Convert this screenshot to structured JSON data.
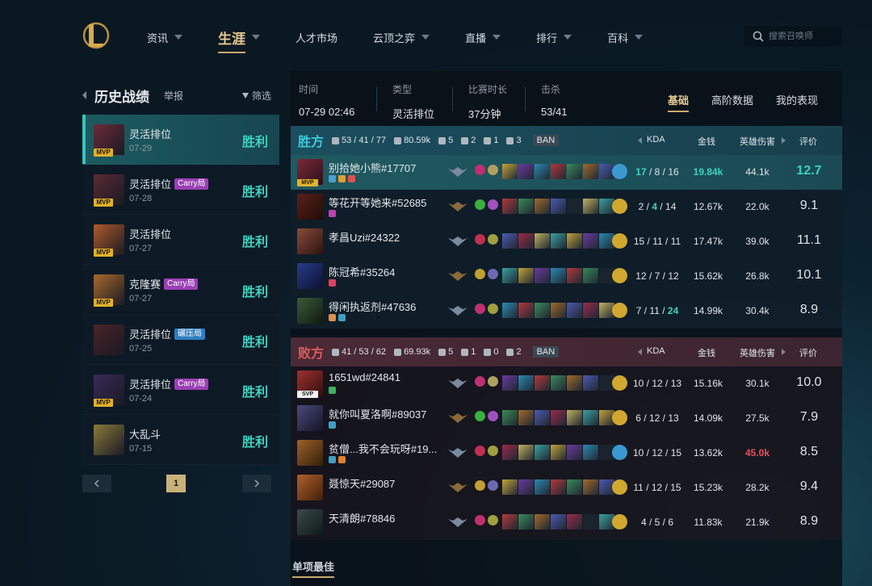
{
  "nav": {
    "items": [
      {
        "label": "资讯",
        "has_caret": true,
        "active": false
      },
      {
        "label": "生涯",
        "has_caret": true,
        "active": true
      },
      {
        "label": "人才市场",
        "has_caret": false,
        "active": false
      },
      {
        "label": "云顶之弈",
        "has_caret": true,
        "active": false
      },
      {
        "label": "直播",
        "has_caret": true,
        "active": false
      },
      {
        "label": "排行",
        "has_caret": true,
        "active": false
      },
      {
        "label": "百科",
        "has_caret": true,
        "active": false
      }
    ],
    "search_placeholder": "搜索召唤师"
  },
  "history": {
    "title": "历史战绩",
    "report": "举报",
    "filter": "筛选",
    "matches": [
      {
        "queue": "灵活排位",
        "tag": "",
        "tag_color": "",
        "date": "07-29",
        "result": "胜利",
        "mvp": true,
        "selected": true,
        "avatar_color": "#6b2a3a"
      },
      {
        "queue": "灵活排位",
        "tag": "Carry局",
        "tag_color": "#9b3fb5",
        "date": "07-28",
        "result": "胜利",
        "mvp": true,
        "selected": false,
        "avatar_color": "#5a2a34"
      },
      {
        "queue": "灵活排位",
        "tag": "",
        "tag_color": "",
        "date": "07-27",
        "result": "胜利",
        "mvp": true,
        "selected": false,
        "avatar_color": "#b05a2a"
      },
      {
        "queue": "克隆赛",
        "tag": "Carry局",
        "tag_color": "#9b3fb5",
        "date": "07-27",
        "result": "胜利",
        "mvp": true,
        "selected": false,
        "avatar_color": "#a86a2a"
      },
      {
        "queue": "灵活排位",
        "tag": "碾压局",
        "tag_color": "#2e7fc2",
        "date": "07-25",
        "result": "胜利",
        "mvp": false,
        "selected": false,
        "avatar_color": "#4a2228"
      },
      {
        "queue": "灵活排位",
        "tag": "Carry局",
        "tag_color": "#9b3fb5",
        "date": "07-24",
        "result": "胜利",
        "mvp": true,
        "selected": false,
        "avatar_color": "#3a2a5a"
      },
      {
        "queue": "大乱斗",
        "tag": "",
        "tag_color": "",
        "date": "07-15",
        "result": "胜利",
        "mvp": false,
        "selected": false,
        "avatar_color": "#8a7a3a"
      }
    ],
    "page": "1"
  },
  "summary": {
    "time_label": "时间",
    "time": "07-29 02:46",
    "type_label": "类型",
    "type": "灵活排位",
    "duration_label": "比赛时长",
    "duration": "37分钟",
    "kills_label": "击杀",
    "kills": "53/41"
  },
  "tabs": [
    "基础",
    "高阶数据",
    "我的表现"
  ],
  "columns": {
    "kda": "KDA",
    "gold": "金钱",
    "damage": "英雄伤害",
    "score": "评价"
  },
  "chart_data": {
    "type": "table",
    "teams": [
      {
        "name": "胜方",
        "kda": "53 / 41 / 77",
        "gold": "80.59k",
        "towers": "5",
        "inhibitors": "2",
        "barons": "1",
        "dragons": "3",
        "ban": "BAN",
        "players": [
          {
            "name": "别拾她小熊#17707",
            "badge": "MVP",
            "kda": [
              17,
              8,
              16
            ],
            "gold": "19.84k",
            "damage": "44.1k",
            "score": "12.7",
            "me": true,
            "hl_k": true,
            "hl_a": false,
            "hl_gold": true,
            "hl_dmg": false
          },
          {
            "name": "等花开等她来#52685",
            "badge": "",
            "kda": [
              2,
              4,
              14
            ],
            "gold": "12.67k",
            "damage": "22.0k",
            "score": "9.1",
            "me": false,
            "hl_d_cyan": true
          },
          {
            "name": "孝昌Uzi#24322",
            "badge": "",
            "kda": [
              15,
              11,
              11
            ],
            "gold": "17.47k",
            "damage": "39.0k",
            "score": "11.1",
            "me": false
          },
          {
            "name": "陈冠希#35264",
            "badge": "",
            "kda": [
              12,
              7,
              12
            ],
            "gold": "15.62k",
            "damage": "26.8k",
            "score": "10.1",
            "me": false
          },
          {
            "name": "得闲执返剂#47636",
            "badge": "",
            "kda": [
              7,
              11,
              24
            ],
            "gold": "14.99k",
            "damage": "30.4k",
            "score": "8.9",
            "me": false,
            "hl_a": true
          }
        ]
      },
      {
        "name": "败方",
        "kda": "41 / 53 / 62",
        "gold": "69.93k",
        "towers": "5",
        "inhibitors": "1",
        "barons": "0",
        "dragons": "2",
        "ban": "BAN",
        "players": [
          {
            "name": "1651wd#24841",
            "badge": "SVP",
            "kda": [
              10,
              12,
              13
            ],
            "gold": "15.16k",
            "damage": "30.1k",
            "score": "10.0",
            "me": false
          },
          {
            "name": "就你叫夏洛啊#89037",
            "badge": "",
            "kda": [
              6,
              12,
              13
            ],
            "gold": "14.09k",
            "damage": "27.5k",
            "score": "7.9",
            "me": false
          },
          {
            "name": "贫僧...我不会玩呀#19...",
            "badge": "",
            "kda": [
              10,
              12,
              15
            ],
            "gold": "13.62k",
            "damage": "45.0k",
            "score": "8.5",
            "me": false,
            "hl_dmg_red": true
          },
          {
            "name": "聂惊天#29087",
            "badge": "",
            "kda": [
              11,
              12,
              15
            ],
            "gold": "15.23k",
            "damage": "28.2k",
            "score": "9.4",
            "me": false
          },
          {
            "name": "天清朗#78846",
            "badge": "",
            "kda": [
              4,
              5,
              6
            ],
            "gold": "11.83k",
            "damage": "21.9k",
            "score": "8.9",
            "me": false
          }
        ]
      }
    ]
  },
  "best_label": "单项最佳",
  "colors": {
    "accent_gold": "#c8a96a",
    "win_cyan": "#3fd1c0",
    "lose_red": "#e05a5a"
  }
}
